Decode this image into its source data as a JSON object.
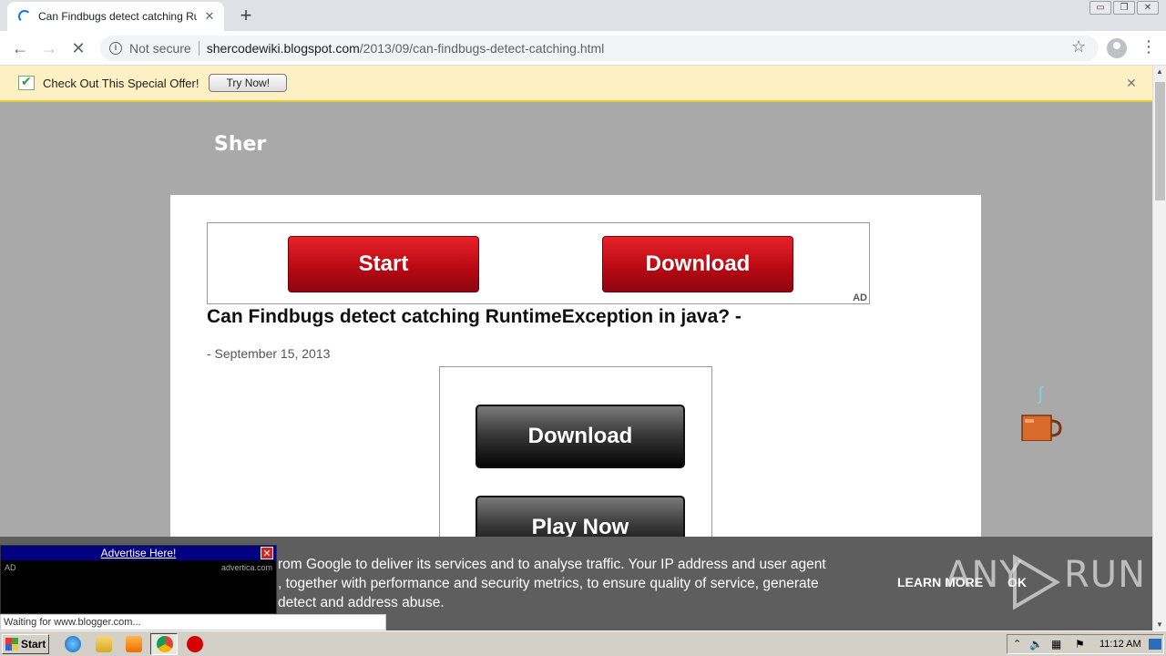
{
  "browser": {
    "tab_title": "Can Findbugs detect catching Runtim",
    "tab_close": "✕",
    "new_tab": "+",
    "window_buttons": [
      "▭",
      "❐",
      "✕"
    ],
    "back": "←",
    "forward": "→",
    "reload": "✕",
    "security_label": "Not secure",
    "url_host": "shercodewiki.blogspot.com",
    "url_path": "/2013/09/can-findbugs-detect-catching.html",
    "star": "☆",
    "menu": "⋮"
  },
  "infobar": {
    "message": "Check Out This Special Offer!",
    "button_label": "Try Now!",
    "close": "✕"
  },
  "page": {
    "site_name": "Sher",
    "top_ad": {
      "start_label": "Start",
      "download_label": "Download",
      "ad_label": "AD"
    },
    "post_title": "Can Findbugs detect catching RuntimeException in java? -",
    "post_date": "- September 15, 2013",
    "side_ad": {
      "download_label": "Download",
      "play_label": "Play Now"
    }
  },
  "cookie": {
    "line1": "rom Google to deliver its services and to analyse traffic. Your IP address and user agent",
    "line2": ", together with performance and security metrics, to ensure quality of service, generate",
    "line3": "detect and address abuse.",
    "learn_more": "LEARN MORE",
    "ok": "OK"
  },
  "watermark": {
    "text_left": "ANY",
    "text_right": "RUN"
  },
  "adv_ad": {
    "header": "Advertise Here!",
    "close": "✕",
    "ad_label": "AD",
    "source": "advertica.com"
  },
  "status_text": "Waiting for www.blogger.com...",
  "taskbar": {
    "start_label": "Start",
    "clock": "11:12 AM"
  }
}
